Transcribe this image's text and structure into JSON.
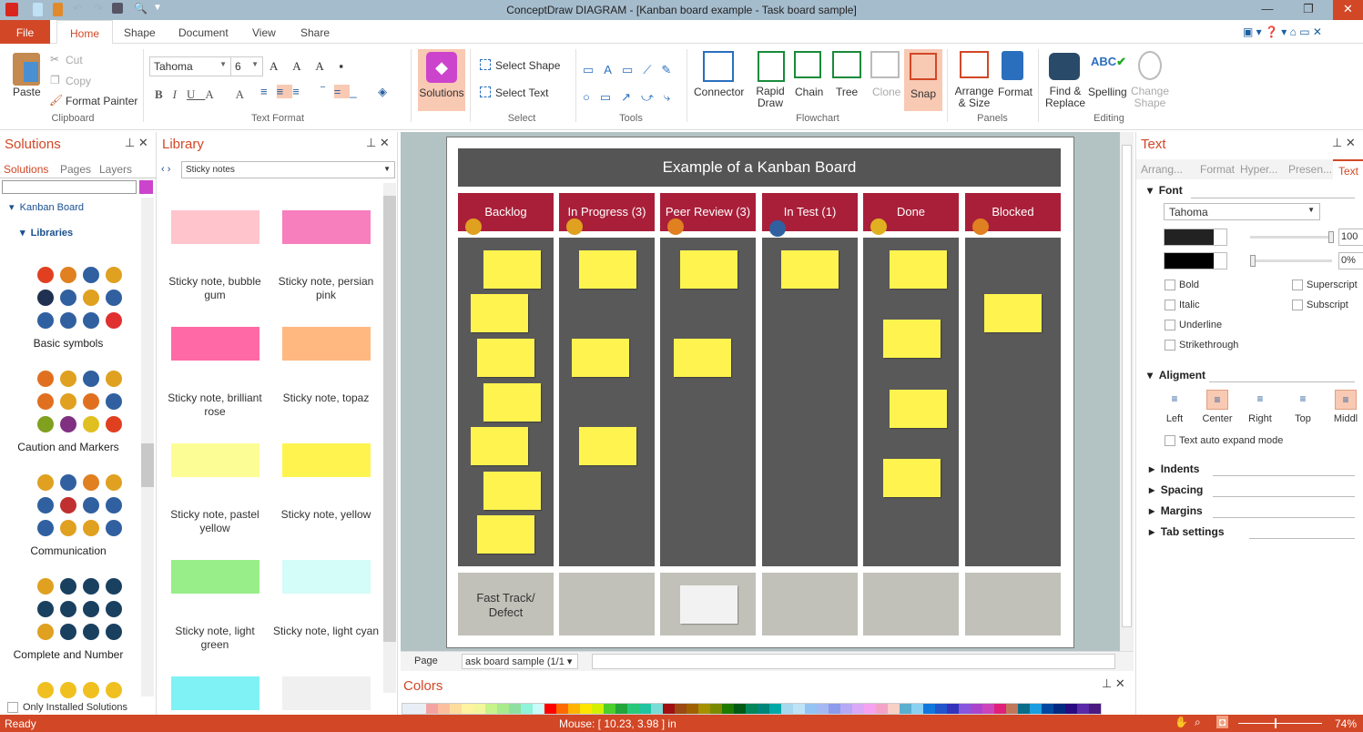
{
  "window": {
    "title": "ConceptDraw DIAGRAM - [Kanban board example - Task board sample]"
  },
  "menu": {
    "file": "File",
    "tabs": [
      "Home",
      "Shape",
      "Document",
      "View",
      "Share"
    ]
  },
  "ribbon": {
    "clipboard": {
      "paste": "Paste",
      "cut": "Cut",
      "copy": "Copy",
      "format_painter": "Format Painter",
      "group": "Clipboard"
    },
    "text_format": {
      "font": "Tahoma",
      "size": "6",
      "group": "Text Format"
    },
    "solutions": "Solutions",
    "select": {
      "select_shape": "Select Shape",
      "select_text": "Select Text",
      "group": "Select"
    },
    "tools": {
      "group": "Tools"
    },
    "flowchart": {
      "connector": "Connector",
      "rapid_draw": "Rapid Draw",
      "chain": "Chain",
      "tree": "Tree",
      "clone": "Clone",
      "snap": "Snap",
      "group": "Flowchart"
    },
    "panels": {
      "arrange": "Arrange & Size",
      "format": "Format",
      "group": "Panels"
    },
    "editing": {
      "find": "Find & Replace",
      "spelling": "Spelling",
      "change_shape": "Change Shape",
      "group": "Editing"
    }
  },
  "solutions_panel": {
    "title": "Solutions",
    "tabs": [
      "Solutions",
      "Pages",
      "Layers"
    ],
    "tree": [
      "Kanban Board",
      "Libraries"
    ],
    "groups": [
      "Basic symbols",
      "Caution and Markers",
      "Communication",
      "Complete and Number"
    ],
    "only_installed": "Only Installed Solutions"
  },
  "library_panel": {
    "title": "Library",
    "selected": "Sticky notes",
    "items": [
      {
        "label": "Sticky note, bubble gum",
        "color": "#ffc4cc"
      },
      {
        "label": "Sticky note, persian pink",
        "color": "#f77fbe"
      },
      {
        "label": "Sticky note, brilliant rose",
        "color": "#ff69a6"
      },
      {
        "label": "Sticky note, topaz",
        "color": "#ffb880"
      },
      {
        "label": "Sticky note, pastel yellow",
        "color": "#fdfd96"
      },
      {
        "label": "Sticky note, yellow",
        "color": "#fff44f"
      },
      {
        "label": "Sticky note, light green",
        "color": "#98ee88"
      },
      {
        "label": "Sticky note, light cyan",
        "color": "#d4fcf8"
      },
      {
        "label": "",
        "color": "#7ff2f6"
      },
      {
        "label": "",
        "color": "#f0f0f0"
      }
    ]
  },
  "board": {
    "title": "Example of a Kanban Board",
    "columns": [
      "Backlog",
      "In Progress (3)",
      "Peer Review (3)",
      "In Test (1)",
      "Done",
      "Blocked"
    ],
    "footer": "Fast Track/ Defect"
  },
  "page_nav": {
    "label": "Page",
    "page": "ask board sample (1/1"
  },
  "colors_panel": {
    "title": "Colors",
    "swatches": [
      "#f4a3a3",
      "#fbbf9f",
      "#fddc9e",
      "#fdf3a0",
      "#f3f79c",
      "#c6f38c",
      "#a8ea8c",
      "#8fe0a0",
      "#8ff3d9",
      "#c9fbf9",
      "#ff0000",
      "#ff6a00",
      "#ffb300",
      "#ffe600",
      "#d4f000",
      "#4cce2c",
      "#22a53a",
      "#28c87a",
      "#20c4a0",
      "#7adcd6",
      "#a00f12",
      "#9a4a12",
      "#a06000",
      "#a59000",
      "#7a8a00",
      "#1e7a00",
      "#005a16",
      "#00865a",
      "#00857a",
      "#00a8a8",
      "#a6d8ee",
      "#bfe3f7",
      "#93c3f3",
      "#a4b8f2",
      "#8c9bea",
      "#b5a8f5",
      "#d9a8f6",
      "#f6a2f0",
      "#f3a2c8",
      "#f8d0c6",
      "#5aafcf",
      "#8ad0f2",
      "#1177dd",
      "#2255cc",
      "#3333bb",
      "#8855dd",
      "#aa44cc",
      "#cc44bb",
      "#e0207a",
      "#c0785a",
      "#0a6e8a",
      "#1a9ee0",
      "#0047a0",
      "#002a80",
      "#2a0a80",
      "#5a2aa8",
      "#4a1a80"
    ]
  },
  "text_panel": {
    "title": "Text",
    "tabs": [
      "Arrang...",
      "Format",
      "Hyper...",
      "Presen...",
      "Text"
    ],
    "font_section": "Font",
    "font": "Tahoma",
    "opacity1": "100",
    "opacity2": "0%",
    "checks": [
      "Bold",
      "Italic",
      "Underline",
      "Strikethrough",
      "Superscript",
      "Subscript"
    ],
    "alignment_section": "Aligment",
    "align": [
      "Left",
      "Center",
      "Right",
      "Top",
      "Middl"
    ],
    "auto_expand": "Text auto expand mode",
    "sections": [
      "Indents",
      "Spacing",
      "Margins",
      "Tab settings"
    ],
    "colors": {
      "text": "#222222",
      "bg": "#000000"
    }
  },
  "status": {
    "ready": "Ready",
    "mouse": "Mouse: [ 10.23, 3.98 ] in",
    "zoom": "74%"
  }
}
